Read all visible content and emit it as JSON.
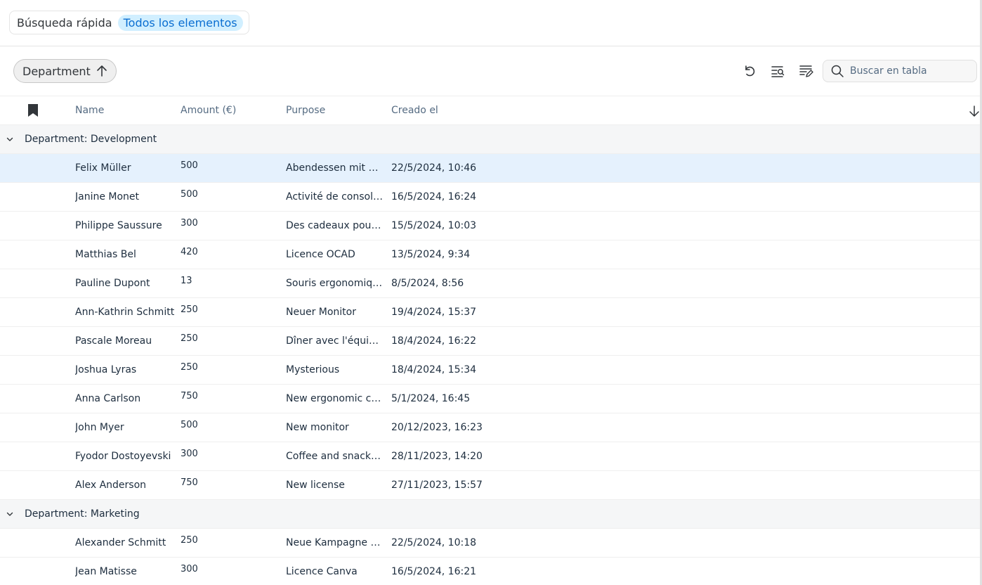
{
  "quick_search": {
    "label": "Búsqueda rápida",
    "active_filter": "Todos los elementos"
  },
  "toolbar": {
    "sort_chip_label": "Department",
    "search_placeholder": "Buscar en tabla"
  },
  "table": {
    "columns": [
      "Name",
      "Amount (€)",
      "Purpose",
      "Creado el"
    ],
    "groups": [
      {
        "label": "Department: Development",
        "rows": [
          {
            "name": "Felix Müller",
            "amount": "500",
            "purpose": "Abendessen mit dem Team",
            "created": "22/5/2024, 10:46",
            "selected": true
          },
          {
            "name": "Janine Monet",
            "amount": "500",
            "purpose": "Activité de consolidation",
            "created": "16/5/2024, 16:24"
          },
          {
            "name": "Philippe Saussure",
            "amount": "300",
            "purpose": "Des cadeaux pour les clients",
            "created": "15/5/2024, 10:03"
          },
          {
            "name": "Matthias Bel",
            "amount": "420",
            "purpose": "Licence OCAD",
            "created": "13/5/2024, 9:34"
          },
          {
            "name": "Pauline Dupont",
            "amount": "13",
            "purpose": "Souris ergonomique",
            "created": "8/5/2024, 8:56"
          },
          {
            "name": "Ann-Kathrin Schmitt",
            "amount": "250",
            "purpose": "Neuer Monitor",
            "created": "19/4/2024, 15:37"
          },
          {
            "name": "Pascale Moreau",
            "amount": "250",
            "purpose": "Dîner avec l'équipe de projet",
            "created": "18/4/2024, 16:22"
          },
          {
            "name": "Joshua Lyras",
            "amount": "250",
            "purpose": "Mysterious",
            "created": "18/4/2024, 15:34"
          },
          {
            "name": "Anna Carlson",
            "amount": "750",
            "purpose": "New ergonomic chair",
            "created": "5/1/2024, 16:45"
          },
          {
            "name": "John Myer",
            "amount": "500",
            "purpose": "New monitor",
            "created": "20/12/2023, 16:23"
          },
          {
            "name": "Fyodor Dostoyevski",
            "amount": "300",
            "purpose": "Coffee and snacks for the team",
            "created": "28/11/2023, 14:20"
          },
          {
            "name": "Alex Anderson",
            "amount": "750",
            "purpose": "New license",
            "created": "27/11/2023, 15:57"
          }
        ]
      },
      {
        "label": "Department: Marketing",
        "rows": [
          {
            "name": "Alexander Schmitt",
            "amount": "250",
            "purpose": "Neue Kampagne für Social Media",
            "created": "22/5/2024, 10:18"
          },
          {
            "name": "Jean Matisse",
            "amount": "300",
            "purpose": "Licence Canva",
            "created": "16/5/2024, 16:21"
          }
        ]
      }
    ]
  },
  "colors": {
    "accent": "#0a6ed1",
    "pill_bg": "#d1efff",
    "selected_row": "#e5f1fd",
    "group_row": "#f5f6f7"
  }
}
